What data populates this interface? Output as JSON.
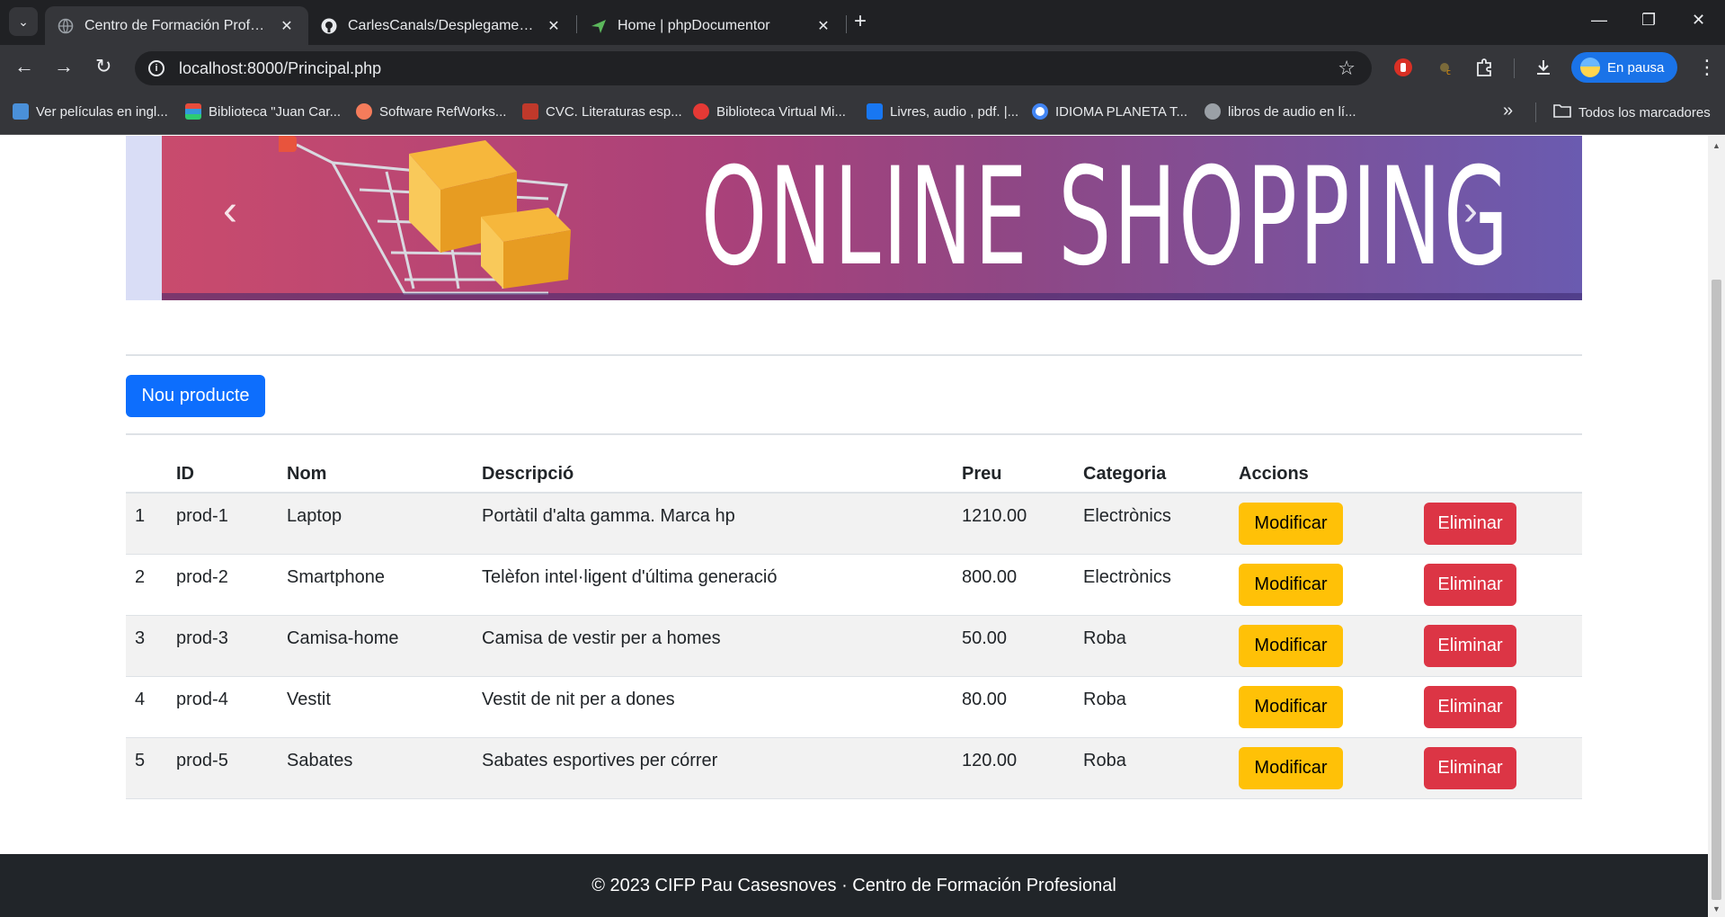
{
  "browser": {
    "tabs": [
      {
        "title": "Centro de Formación Profesional",
        "active": true
      },
      {
        "title": "CarlesCanals/Desplegament-web",
        "active": false
      },
      {
        "title": "Home | phpDocumentor",
        "active": false
      }
    ],
    "new_tab": "+",
    "address": "localhost:8000/Principal.php",
    "profile_label": "En pausa",
    "bookmarks": [
      "Ver películas en ingl...",
      "Biblioteca \"Juan Car...",
      "Software RefWorks...",
      "CVC. Literaturas esp...",
      "Biblioteca Virtual Mi...",
      "Livres, audio , pdf. |...",
      "IDIOMA PLANETA T...",
      "libros de audio en lí..."
    ],
    "bookmarks_more": "»",
    "all_bookmarks": "Todos los marcadores"
  },
  "banner": {
    "headline": "ONLINE SHOPPING"
  },
  "actions": {
    "new_product": "Nou producte"
  },
  "table": {
    "headers": [
      "",
      "ID",
      "Nom",
      "Descripció",
      "Preu",
      "Categoria",
      "Accions",
      ""
    ],
    "rows": [
      {
        "n": "1",
        "id": "prod-1",
        "nom": "Laptop",
        "desc": "Portàtil d'alta gamma. Marca hp",
        "preu": "1210.00",
        "cat": "Electrònics"
      },
      {
        "n": "2",
        "id": "prod-2",
        "nom": "Smartphone",
        "desc": "Telèfon intel·ligent d'última generació",
        "preu": "800.00",
        "cat": "Electrònics"
      },
      {
        "n": "3",
        "id": "prod-3",
        "nom": "Camisa-home",
        "desc": "Camisa de vestir per a homes",
        "preu": "50.00",
        "cat": "Roba"
      },
      {
        "n": "4",
        "id": "prod-4",
        "nom": "Vestit",
        "desc": "Vestit de nit per a dones",
        "preu": "80.00",
        "cat": "Roba"
      },
      {
        "n": "5",
        "id": "prod-5",
        "nom": "Sabates",
        "desc": "Sabates esportives per córrer",
        "preu": "120.00",
        "cat": "Roba"
      }
    ],
    "modify_label": "Modificar",
    "delete_label": "Eliminar"
  },
  "footer": {
    "text": "© 2023 CIFP Pau Casesnoves · Centro de Formación Profesional"
  },
  "colors": {
    "primary": "#0d6efd",
    "warning": "#ffc107",
    "danger": "#dc3545",
    "footer_bg": "#212529"
  }
}
